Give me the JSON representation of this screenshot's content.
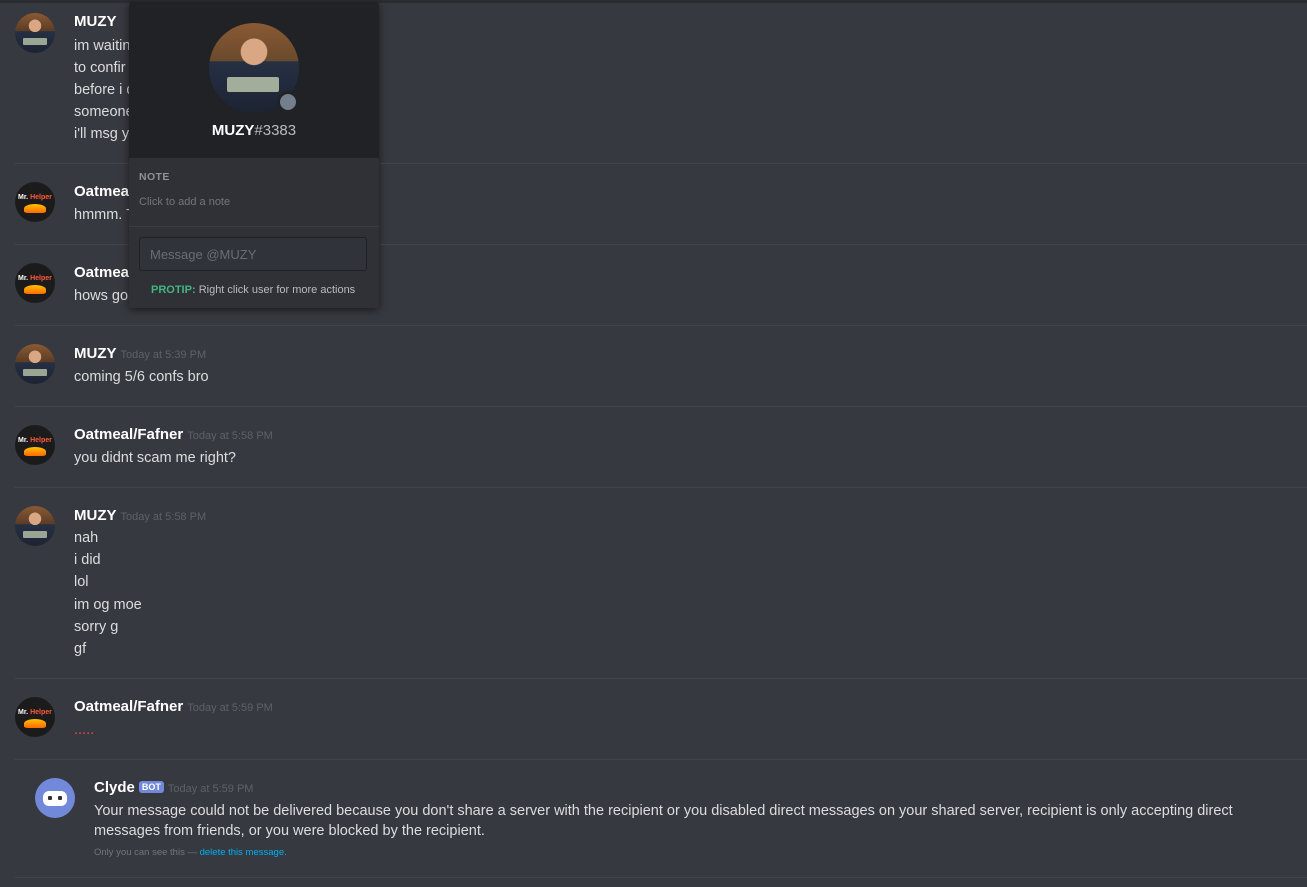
{
  "groups": [
    {
      "author": "MUZY",
      "timestamp": "",
      "lines": [
        "im waitin",
        "to confir",
        "before i d",
        "someone",
        "i'll msg y"
      ]
    },
    {
      "author": "Oatmea",
      "timestamp": "",
      "lines": [
        "hmmm. T"
      ]
    },
    {
      "author": "Oatmea",
      "timestamp": "",
      "lines": [
        "hows goi"
      ]
    },
    {
      "author": "MUZY",
      "timestamp": "Today at 5:39 PM",
      "lines": [
        "coming 5/6 confs bro"
      ]
    },
    {
      "author": "Oatmeal/Fafner",
      "timestamp": "Today at 5:58 PM",
      "lines": [
        "you didnt scam me right?"
      ]
    },
    {
      "author": "MUZY",
      "timestamp": "Today at 5:58 PM",
      "lines": [
        "nah",
        "i did",
        "lol",
        "im og moe",
        "sorry g",
        "gf"
      ]
    },
    {
      "author": "Oatmeal/Fafner",
      "timestamp": "Today at 5:59 PM",
      "lines": [
        "....."
      ]
    }
  ],
  "clyde": {
    "author": "Clyde",
    "bot_tag": "BOT",
    "timestamp": "Today at 5:59 PM",
    "text": "Your message could not be delivered because you don't share a server with the recipient or you disabled direct messages on your shared server, recipient is only accepting direct messages from friends, or you were blocked by the recipient.",
    "notice_prefix": "Only you can see this —",
    "notice_link": "delete this message."
  },
  "popup": {
    "username": "MUZY",
    "discriminator": "#3383",
    "note_label": "NOTE",
    "note_placeholder": "Click to add a note",
    "message_placeholder": "Message @MUZY",
    "protip_label": "PROTIP:",
    "protip_text": "Right click user for more actions"
  },
  "colors": {
    "background": "#36393f",
    "popup_background": "#2f3136",
    "accent": "#7289da",
    "protip": "#43b581",
    "link": "#00b0f4",
    "error_text": "#f04747"
  },
  "icons": {
    "muzy_avatar": "user-avatar-photo",
    "oatmeal_avatar": "mr-helper-avatar",
    "clyde_avatar": "clyde-bot-icon",
    "status": "offline-status-dot"
  }
}
